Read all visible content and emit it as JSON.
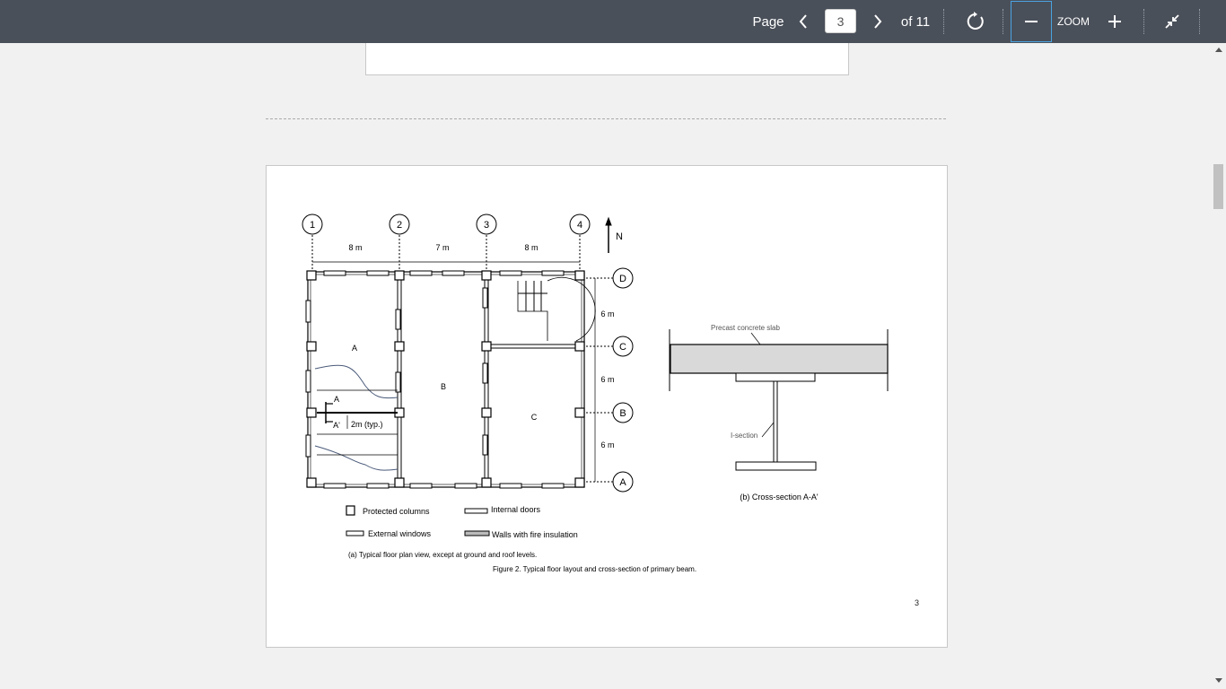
{
  "toolbar": {
    "page_label": "Page",
    "current_page": "3",
    "of_label": "of 11",
    "zoom_label": "ZOOM",
    "icons": [
      "chevron-left-icon",
      "chevron-right-icon",
      "rotate-icon",
      "minus-icon",
      "plus-icon",
      "collapse-icon"
    ]
  },
  "document": {
    "page_number": "3",
    "grid_columns": [
      "1",
      "2",
      "3",
      "4"
    ],
    "grid_rows": [
      "D",
      "C",
      "B",
      "A"
    ],
    "spans_x": [
      "8 m",
      "7 m",
      "8 m"
    ],
    "spans_y": [
      "6 m",
      "6 m",
      "6 m"
    ],
    "north": "N",
    "rooms": [
      "A",
      "B",
      "C"
    ],
    "section_mark": "A",
    "section_mark_prime": "A'",
    "typ_dimension": "2m (typ.)",
    "slab_label": "Precast concrete slab",
    "beam_label": "I-section",
    "caption_b": "(b) Cross-section A-A'",
    "legend": {
      "protected_columns": "Protected columns",
      "internal_doors": "Internal doors",
      "external_windows": "External windows",
      "walls_fire": "Walls with fire insulation"
    },
    "caption_a": "(a) Typical floor plan view, except at ground and roof levels.",
    "figure_caption": "Figure 2. Typical floor layout and cross-section of primary beam."
  }
}
